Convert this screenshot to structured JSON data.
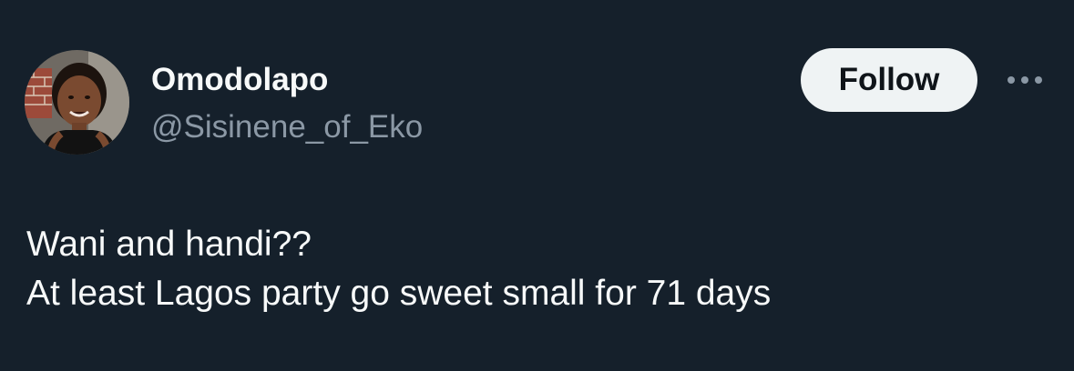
{
  "author": {
    "display_name": "Omodolapo",
    "handle": "@Sisinene_of_Eko",
    "avatar_icon": "profile-photo"
  },
  "actions": {
    "follow_label": "Follow",
    "more_icon": "more-horizontal-icon"
  },
  "tweet": {
    "lines": [
      "Wani and handi??",
      "At least Lagos party go sweet small for 71 days"
    ]
  },
  "colors": {
    "background": "#15202b",
    "primary_text": "#f7f9f9",
    "secondary_text": "#8b98a5",
    "follow_bg": "#eff3f4",
    "follow_text": "#0f1419"
  }
}
